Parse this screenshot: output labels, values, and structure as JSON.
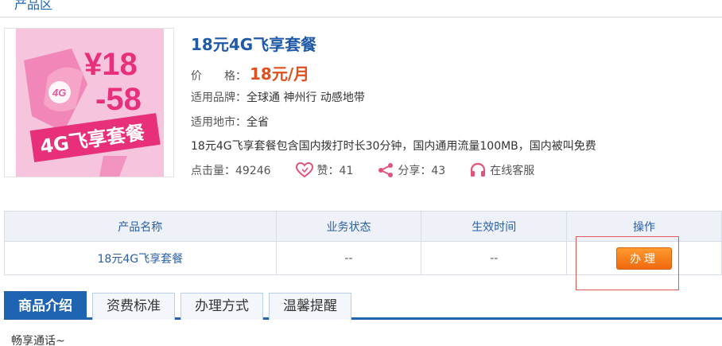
{
  "section": {
    "title": "产品区"
  },
  "product": {
    "name": "18元4G飞享套餐",
    "price_label": "价　　格：",
    "price_value": "18元/月",
    "brand_label": "适用品牌：",
    "brand_value": "全球通 神州行 动感地带",
    "region_label": "适用地市：",
    "region_value": "全省",
    "description": "18元4G飞享套餐包含国内拨打时长30分钟，国内通用流量100MB，国内被叫免费",
    "image": {
      "price_line1": "¥18",
      "price_line2": "-58",
      "banner": "4G飞享套餐",
      "badge": "4G"
    }
  },
  "stats": {
    "clicks": "点击量：49246",
    "likes": "赞：41",
    "shares": "分享：43",
    "service": "在线客服"
  },
  "table": {
    "headers": [
      "产品名称",
      "业务状态",
      "生效时间",
      "操作"
    ],
    "row": {
      "name": "18元4G飞享套餐",
      "status": "--",
      "effective": "--",
      "action": "办理"
    }
  },
  "tabs": [
    {
      "label": "商品介绍",
      "active": true
    },
    {
      "label": "资费标准",
      "active": false
    },
    {
      "label": "办理方式",
      "active": false
    },
    {
      "label": "温馨提醒",
      "active": false
    }
  ],
  "content": {
    "text": "畅享通话~"
  },
  "colors": {
    "primary": "#1f64b2",
    "accent": "#e0501c",
    "button": "#f0680e",
    "highlight_box": "#e05a5a"
  }
}
